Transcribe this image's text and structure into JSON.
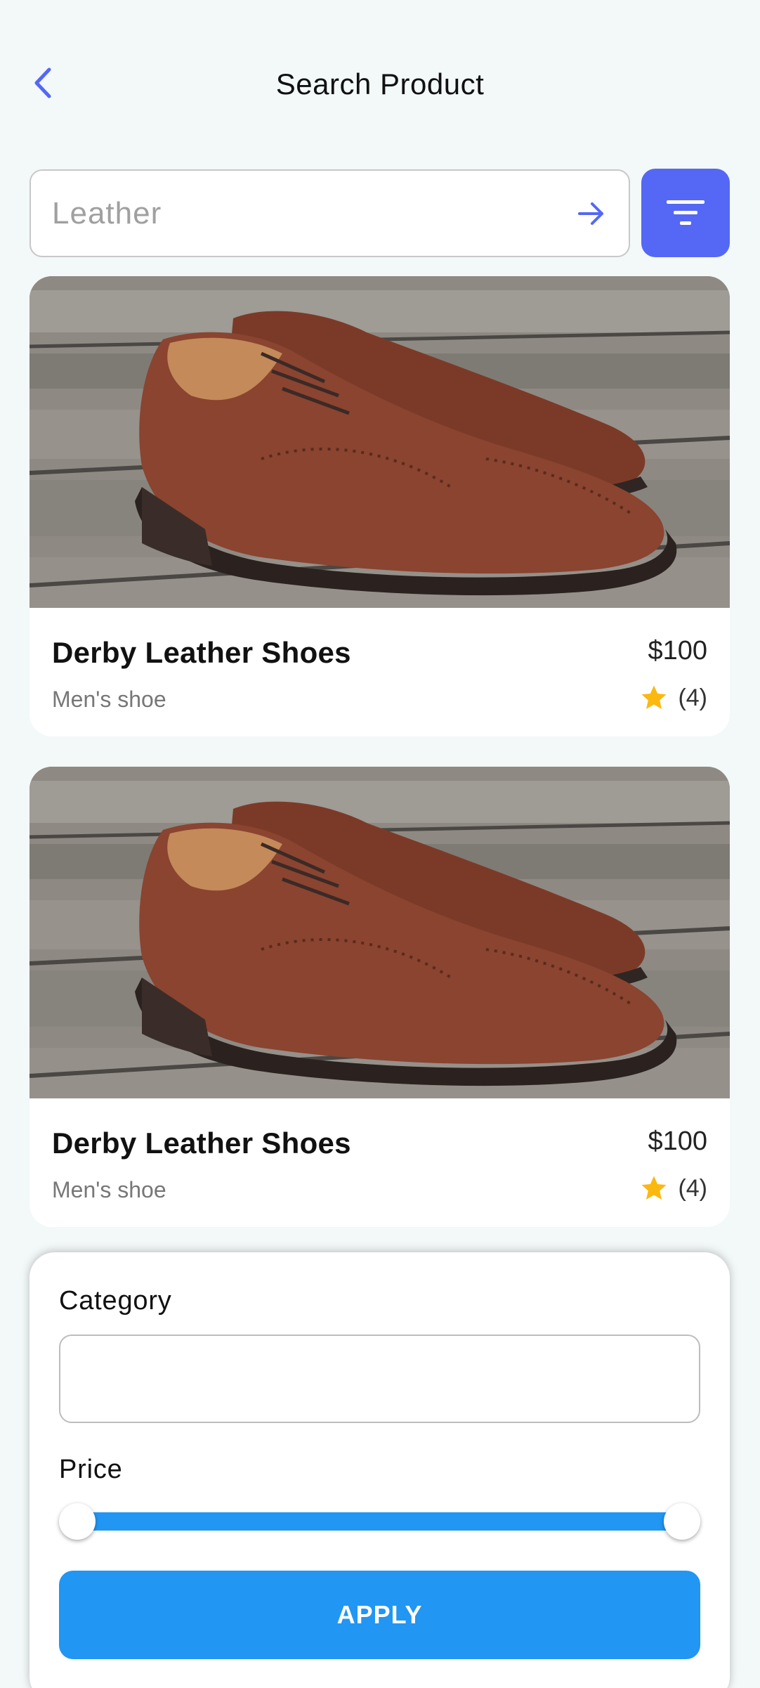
{
  "header": {
    "title": "Search Product"
  },
  "search": {
    "placeholder": "Leather"
  },
  "products": [
    {
      "name": "Derby Leather Shoes",
      "subtitle": "Men's shoe",
      "price": "$100",
      "rating": "(4)"
    },
    {
      "name": "Derby Leather Shoes",
      "subtitle": "Men's shoe",
      "price": "$100",
      "rating": "(4)"
    }
  ],
  "filter": {
    "category_label": "Category",
    "category_value": "",
    "price_label": "Price",
    "price_range": [
      0,
      1
    ],
    "apply_label": "APPLY"
  },
  "colors": {
    "accent": "#5468f5",
    "primary": "#2196f3",
    "star": "#fbb80f"
  }
}
